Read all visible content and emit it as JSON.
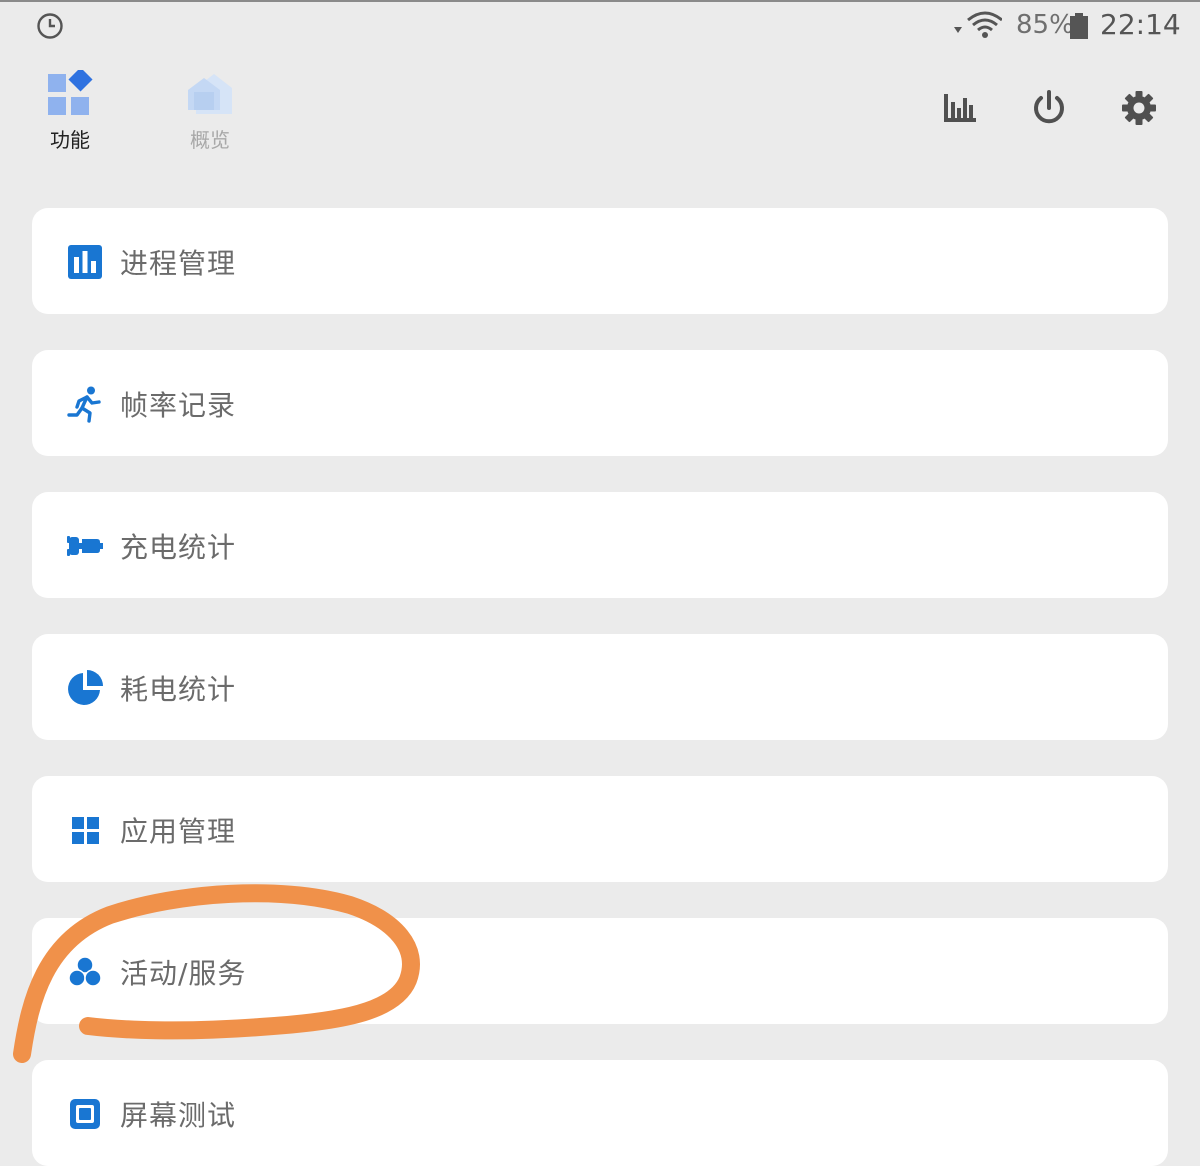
{
  "status_bar": {
    "battery_percent": "85%",
    "time": "22:14"
  },
  "tabs": [
    {
      "label": "功能",
      "icon": "grid-diamond-icon",
      "active": true
    },
    {
      "label": "概览",
      "icon": "house-icon",
      "active": false
    }
  ],
  "header_actions": [
    {
      "icon": "bar-chart-icon"
    },
    {
      "icon": "power-icon"
    },
    {
      "icon": "gear-icon"
    }
  ],
  "menu": {
    "items": [
      {
        "label": "进程管理",
        "icon": "bar-chart-box-icon"
      },
      {
        "label": "帧率记录",
        "icon": "running-person-icon"
      },
      {
        "label": "充电统计",
        "icon": "charging-plug-icon"
      },
      {
        "label": "耗电统计",
        "icon": "pie-chart-icon"
      },
      {
        "label": "应用管理",
        "icon": "app-grid-icon"
      },
      {
        "label": "活动/服务",
        "icon": "circles-cluster-icon"
      },
      {
        "label": "屏幕测试",
        "icon": "screen-square-icon"
      }
    ]
  },
  "colors": {
    "accent": "#1976d2",
    "background": "#ebebeb",
    "card": "#ffffff",
    "annotation": "#f0914a"
  }
}
